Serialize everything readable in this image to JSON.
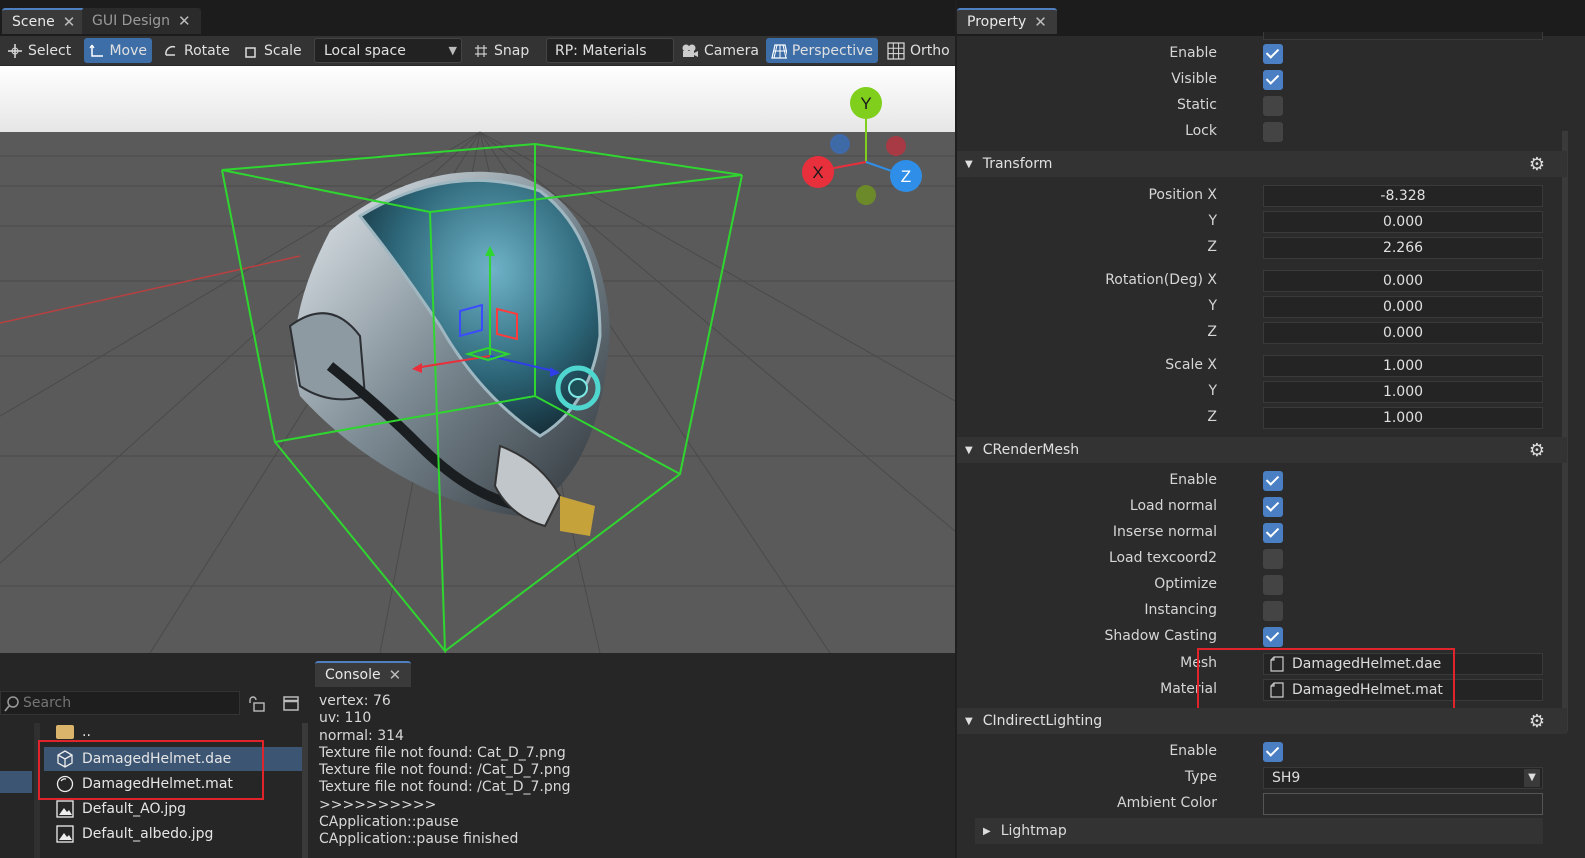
{
  "tabs": [
    {
      "label": "Scene"
    },
    {
      "label": "GUI Design"
    }
  ],
  "toolbar": {
    "select": "Select",
    "move": "Move",
    "rotate": "Rotate",
    "scale": "Scale",
    "space": "Local space",
    "snap": "Snap",
    "rp": "RP: Materials",
    "camera": "Camera",
    "perspective": "Perspective",
    "ortho": "Ortho"
  },
  "gizmo": {
    "y": "Y",
    "x": "X",
    "z": "Z"
  },
  "assets": {
    "search_placeholder": "Search",
    "parent": "..",
    "files": [
      {
        "name": "DamagedHelmet.dae",
        "icon": "mesh-icon"
      },
      {
        "name": "DamagedHelmet.mat",
        "icon": "material-icon"
      },
      {
        "name": "Default_AO.jpg",
        "icon": "image-icon"
      },
      {
        "name": "Default_albedo.jpg",
        "icon": "image-icon"
      }
    ]
  },
  "console": {
    "tab": "Console",
    "lines": [
      "vertex: 76",
      "uv: 110",
      "normal: 314",
      "Texture file not found: Cat_D_7.png",
      "Texture file not found: /Cat_D_7.png",
      "Texture file not found: /Cat_D_7.png",
      ">>>>>>>>>>",
      "CApplication::pause",
      "CApplication::pause finished"
    ]
  },
  "property": {
    "tab": "Property",
    "general": {
      "enable": "Enable",
      "visible": "Visible",
      "static": "Static",
      "lock": "Lock",
      "enable_val": true,
      "visible_val": true,
      "static_val": false,
      "lock_val": false
    },
    "transform": {
      "title": "Transform",
      "position_x_label": "Position X",
      "y_label": "Y",
      "z_label": "Z",
      "rotation_x_label": "Rotation(Deg) X",
      "scale_x_label": "Scale X",
      "position": [
        "-8.328",
        "0.000",
        "2.266"
      ],
      "rotation": [
        "0.000",
        "0.000",
        "0.000"
      ],
      "scale": [
        "1.000",
        "1.000",
        "1.000"
      ]
    },
    "render_mesh": {
      "title": "CRenderMesh",
      "enable": "Enable",
      "load_normal": "Load normal",
      "inserse_normal": "Inserse normal",
      "load_texcoord2": "Load texcoord2",
      "optimize": "Optimize",
      "instancing": "Instancing",
      "shadow_casting": "Shadow Casting",
      "checks": [
        true,
        true,
        true,
        false,
        false,
        false,
        true
      ],
      "mesh_label": "Mesh",
      "mesh_value": "DamagedHelmet.dae",
      "material_label": "Material",
      "material_value": "DamagedHelmet.mat"
    },
    "indirect": {
      "title": "CIndirectLighting",
      "enable": "Enable",
      "enable_val": true,
      "type_label": "Type",
      "type_value": "SH9",
      "ambient_label": "Ambient Color",
      "lightmap": "Lightmap"
    }
  },
  "colors": {
    "accent": "#4a7fc4",
    "highlight_box": "#e0242c",
    "bbox_green": "#2fd62f",
    "axis_x": "#e8303c",
    "axis_y": "#7fcf1c",
    "axis_z": "#2f8fe8"
  }
}
